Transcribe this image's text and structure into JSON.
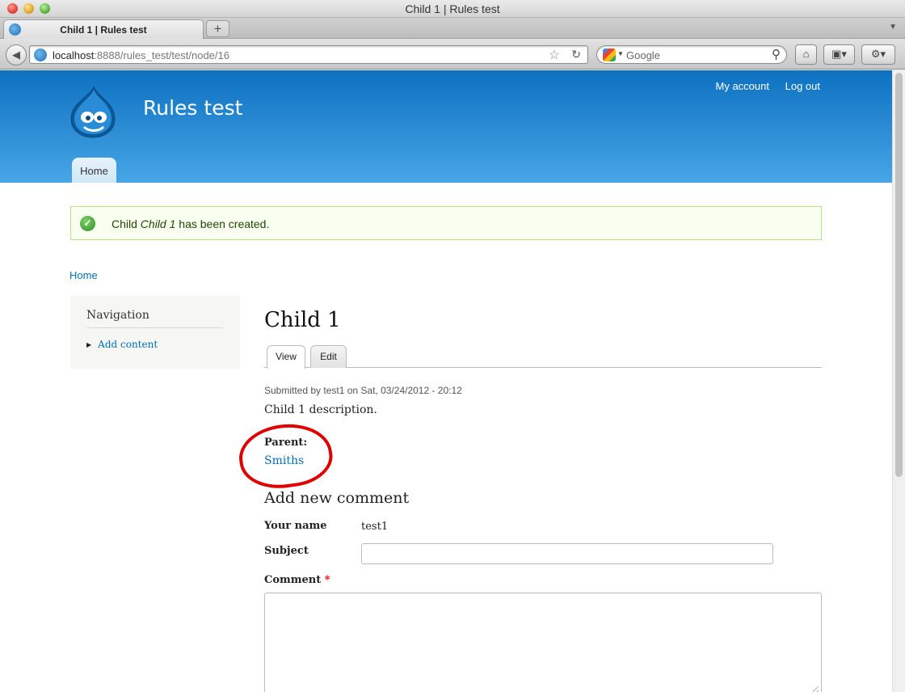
{
  "window": {
    "title": "Child 1 | Rules test"
  },
  "browser": {
    "tab_label": "Child 1 | Rules test",
    "url_host": "localhost",
    "url_rest": ":8888/rules_test/test/node/16",
    "search_placeholder": "Google",
    "new_tab_label": "+"
  },
  "site": {
    "name": "Rules test",
    "secondary_menu": [
      "My account",
      "Log out"
    ],
    "main_menu": [
      "Home"
    ]
  },
  "message": {
    "prefix": "Child ",
    "emphasis": "Child 1",
    "suffix": " has been created."
  },
  "breadcrumb": "Home",
  "sidebar": {
    "title": "Navigation",
    "links": [
      "Add content"
    ]
  },
  "node": {
    "title": "Child 1",
    "tabs": [
      "View",
      "Edit"
    ],
    "submitted": "Submitted by test1 on Sat, 03/24/2012 - 20:12",
    "body": "Child 1 description.",
    "field_label": "Parent:",
    "field_value": "Smiths"
  },
  "comment_form": {
    "heading": "Add new comment",
    "name_label": "Your name",
    "name_value": "test1",
    "subject_label": "Subject",
    "subject_value": "",
    "comment_label": "Comment",
    "required_marker": "*"
  },
  "colors": {
    "header_top": "#0d71c1",
    "header_bottom": "#47a6e6",
    "link": "#0071b3",
    "annotation": "#e00000",
    "message_bg": "#f8fff0"
  }
}
